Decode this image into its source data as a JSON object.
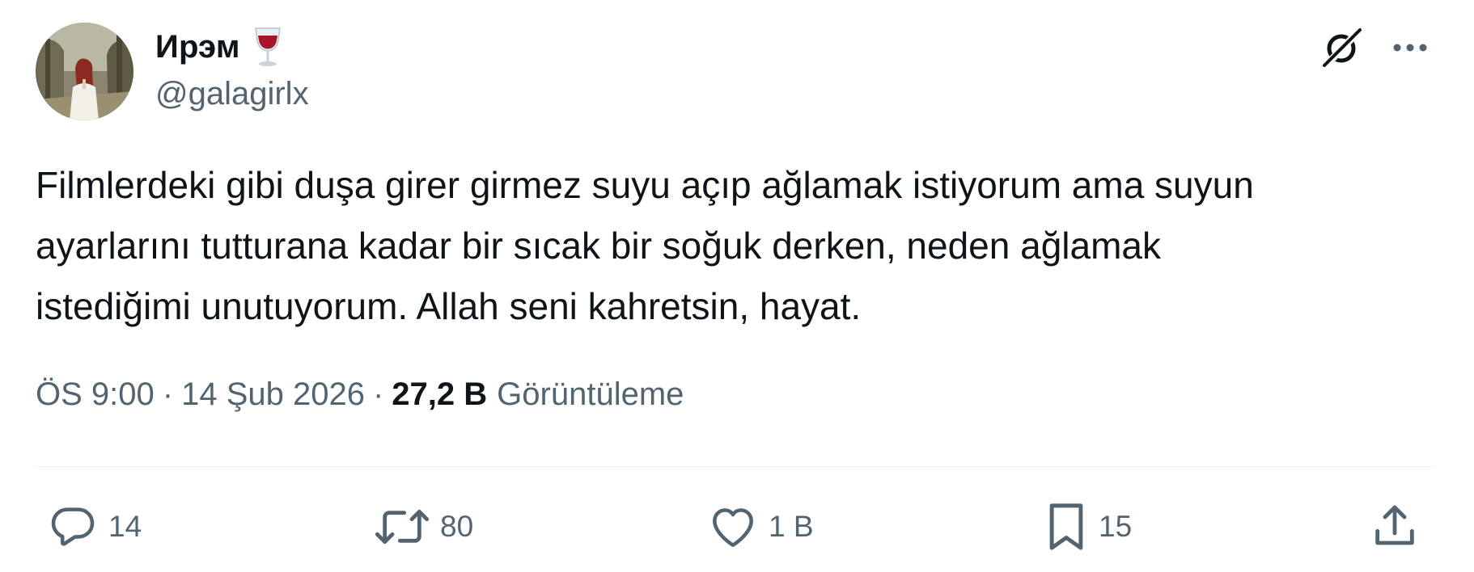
{
  "author": {
    "display_name": "Ирэм",
    "name_emoji": "wine-glass",
    "handle": "@galagirlx",
    "avatar": "profile-photo"
  },
  "header_actions": {
    "grok_icon": "grok-icon",
    "more_icon": "more-options-icon"
  },
  "tweet": {
    "text": "Filmlerdeki gibi duşa girer girmez suyu açıp ağlamak istiyorum ama suyun\nayarlarını tutturana kadar bir sıcak bir soğuk derken, neden ağlamak\nistediğimi unutuyorum. Allah seni kahretsin, hayat."
  },
  "meta": {
    "time": "ÖS 9:00",
    "separator": "·",
    "date": "14 Şub 2026",
    "views_count": "27,2 B",
    "views_label": "Görüntüleme"
  },
  "actions": {
    "replies": "14",
    "reposts": "80",
    "likes": "1 B",
    "bookmarks": "15"
  },
  "colors": {
    "text": "#0f1419",
    "secondary": "#536471",
    "divider": "#eff3f4"
  }
}
